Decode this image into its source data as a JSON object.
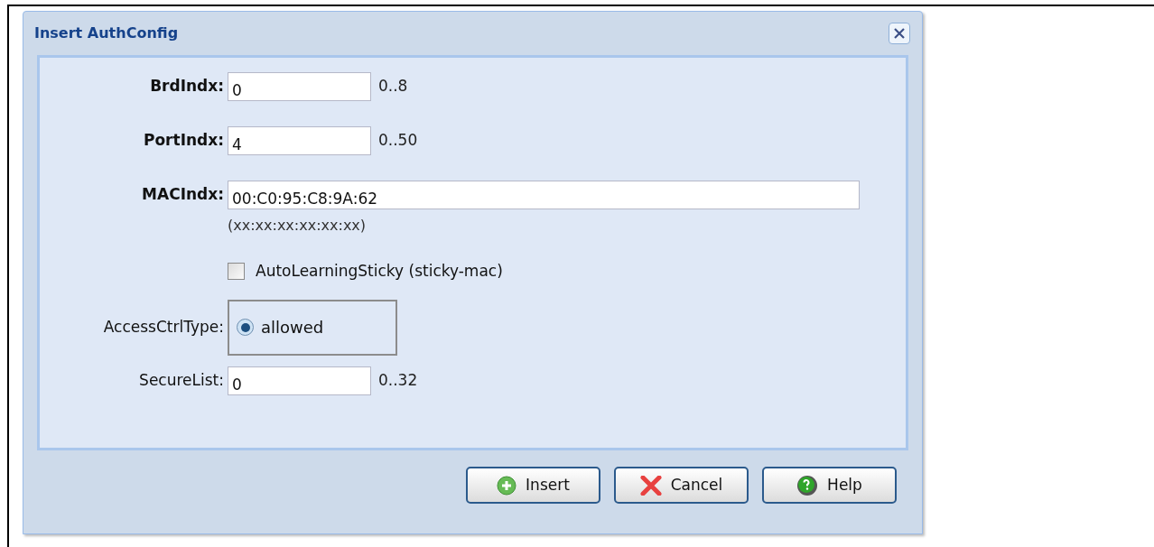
{
  "dialog": {
    "title": "Insert AuthConfig"
  },
  "rows": [
    {
      "kind": "text",
      "label": "BrdIndx:",
      "bold": true,
      "value": "0",
      "range": "0..8"
    },
    {
      "kind": "text",
      "label": "PortIndx:",
      "bold": true,
      "value": "4",
      "range": "0..50"
    },
    {
      "kind": "wide",
      "label": "MACIndx:",
      "bold": true,
      "value": "00:C0:95:C8:9A:62",
      "note": "(xx:xx:xx:xx:xx:xx)"
    },
    {
      "kind": "checkbox",
      "text": "AutoLearningSticky (sticky-mac)",
      "checked": false
    },
    {
      "kind": "radio",
      "label": "AccessCtrlType:",
      "bold": false,
      "options": [
        {
          "text": "allowed",
          "selected": true
        }
      ]
    },
    {
      "kind": "text",
      "label": "SecureList:",
      "bold": false,
      "value": "0",
      "range": "0..32"
    }
  ],
  "buttons": [
    {
      "kind": "insert",
      "label": "Insert"
    },
    {
      "kind": "cancel",
      "label": "Cancel"
    },
    {
      "kind": "help",
      "label": "Help"
    }
  ]
}
